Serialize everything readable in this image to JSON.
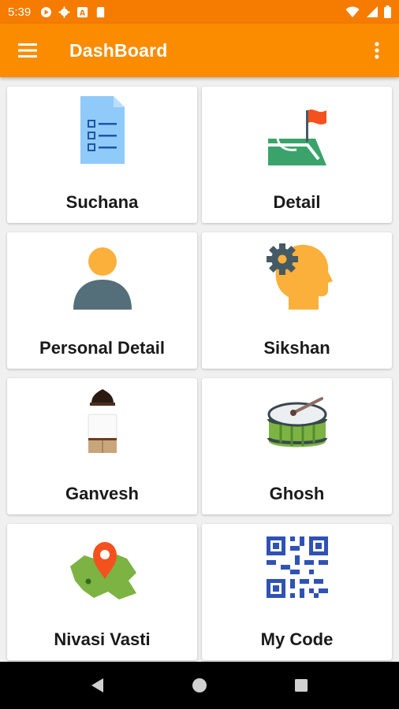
{
  "status_bar": {
    "time": "5:39"
  },
  "app_bar": {
    "title": "DashBoard"
  },
  "tiles": [
    {
      "label": "Suchana",
      "icon": "document-list-icon"
    },
    {
      "label": "Detail",
      "icon": "field-flag-icon"
    },
    {
      "label": "Personal Detail",
      "icon": "person-icon"
    },
    {
      "label": "Sikshan",
      "icon": "head-gear-icon"
    },
    {
      "label": "Ganvesh",
      "icon": "uniform-icon"
    },
    {
      "label": "Ghosh",
      "icon": "drum-icon"
    },
    {
      "label": "Nivasi Vasti",
      "icon": "map-pin-icon"
    },
    {
      "label": "My Code",
      "icon": "qr-code-icon"
    }
  ],
  "colors": {
    "status_bar": "#f57c00",
    "app_bar": "#fb8c00",
    "card": "#ffffff",
    "nav_bar": "#000000"
  }
}
